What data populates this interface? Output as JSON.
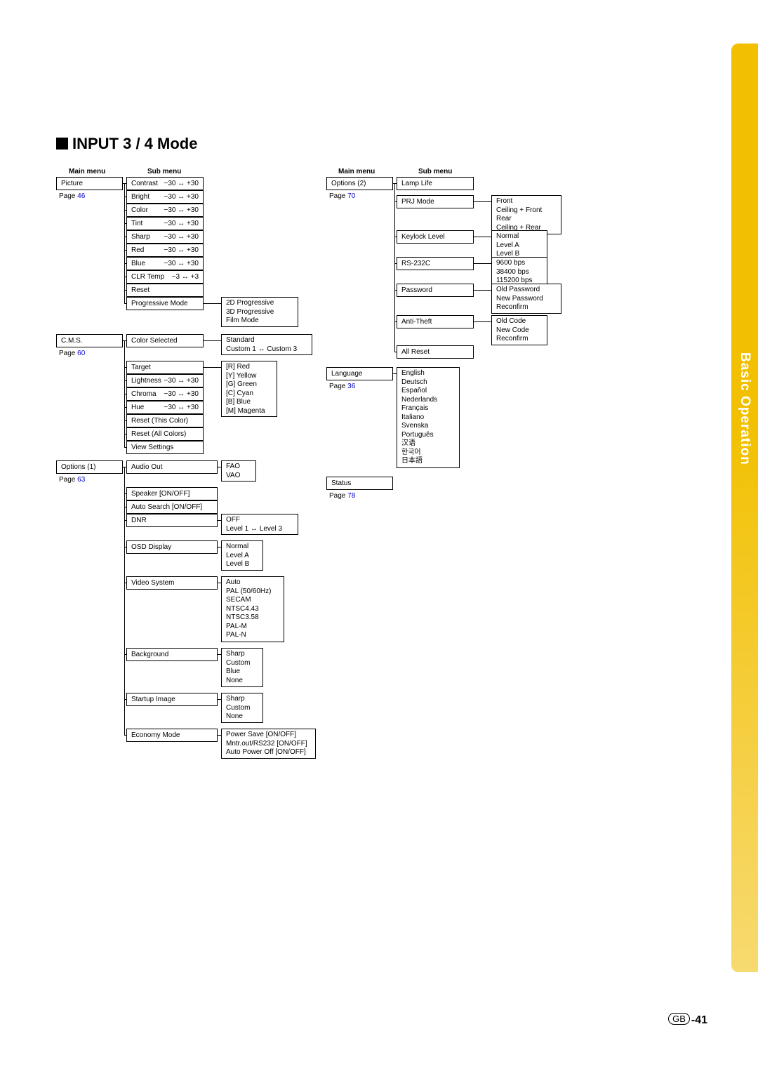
{
  "heading": "INPUT 3 / 4 Mode",
  "side_tab": "Basic Operation",
  "footer_region": "GB",
  "footer_page": "-41",
  "headers": {
    "main_left": "Main menu",
    "sub_left": "Sub menu",
    "main_right": "Main menu",
    "sub_right": "Sub menu"
  },
  "main_left": {
    "picture": {
      "label": "Picture",
      "page": "46"
    },
    "cms": {
      "label": "C.M.S.",
      "page": "60"
    },
    "options1": {
      "label": "Options (1)",
      "page": "63"
    }
  },
  "main_right": {
    "options2": {
      "label": "Options (2)",
      "page": "70"
    },
    "language": {
      "label": "Language",
      "page": "36"
    },
    "status": {
      "label": "Status",
      "page": "78"
    }
  },
  "picture_sub": {
    "contrast": "Contrast",
    "bright": "Bright",
    "color": "Color",
    "tint": "Tint",
    "sharp": "Sharp",
    "red": "Red",
    "blue": "Blue",
    "clr_temp": "CLR Temp",
    "reset": "Reset",
    "progressive": "Progressive Mode"
  },
  "picture_ranges": {
    "r30": "−30 ↔ +30",
    "r3": "−3 ↔ +3"
  },
  "progressive_opts": {
    "a": "2D Progressive",
    "b": "3D Progressive",
    "c": "Film Mode"
  },
  "cms_sub": {
    "color_selected": "Color Selected",
    "target": "Target",
    "lightness": "Lightness",
    "chroma": "Chroma",
    "hue": "Hue",
    "reset_this": "Reset (This Color)",
    "reset_all": "Reset (All Colors)",
    "view": "View Settings"
  },
  "color_selected_opts": {
    "a": "Standard",
    "b": "Custom 1 ↔ Custom 3"
  },
  "target_opts": {
    "r": "[R] Red",
    "y": "[Y] Yellow",
    "g": "[G] Green",
    "c": "[C] Cyan",
    "b": "[B] Blue",
    "m": "[M] Magenta"
  },
  "options1_sub": {
    "audio_out": "Audio Out",
    "speaker": "Speaker [ON/OFF]",
    "auto_search": "Auto Search  [ON/OFF]",
    "dnr": "DNR",
    "osd": "OSD Display",
    "video_system": "Video System",
    "background": "Background",
    "startup": "Startup Image",
    "economy": "Economy Mode"
  },
  "audio_out_opts": {
    "a": "FAO",
    "b": "VAO"
  },
  "dnr_opts": {
    "a": "OFF",
    "b": "Level 1 ↔ Level 3"
  },
  "osd_opts": {
    "a": "Normal",
    "b": "Level A",
    "c": "Level B"
  },
  "video_opts": {
    "a": "Auto",
    "b": "PAL (50/60Hz)",
    "c": "SECAM",
    "d": "NTSC4.43",
    "e": "NTSC3.58",
    "f": "PAL-M",
    "g": "PAL-N"
  },
  "bg_opts": {
    "a": "Sharp",
    "b": "Custom",
    "c": "Blue",
    "d": "None"
  },
  "startup_opts": {
    "a": "Sharp",
    "b": "Custom",
    "c": "None"
  },
  "economy_opts": {
    "a": "Power Save [ON/OFF]",
    "b": "Mntr.out/RS232 [ON/OFF]",
    "c": "Auto Power Off [ON/OFF]"
  },
  "options2_sub": {
    "lamp": "Lamp Life",
    "prj": "PRJ Mode",
    "keylock": "Keylock Level",
    "rs232": "RS-232C",
    "password": "Password",
    "antitheft": "Anti-Theft",
    "allreset": "All Reset"
  },
  "prj_opts": {
    "a": "Front",
    "b": "Ceiling + Front",
    "c": "Rear",
    "d": "Ceiling + Rear"
  },
  "keylock_opts": {
    "a": "Normal",
    "b": "Level A",
    "c": "Level B"
  },
  "rs232_opts": {
    "a": "9600 bps",
    "b": "38400 bps",
    "c": "115200 bps"
  },
  "password_opts": {
    "a": "Old Password",
    "b": "New Password",
    "c": "Reconfirm"
  },
  "antitheft_opts": {
    "a": "Old Code",
    "b": "New Code",
    "c": "Reconfirm"
  },
  "language_opts": {
    "a": "English",
    "b": "Deutsch",
    "c": "Español",
    "d": "Nederlands",
    "e": "Français",
    "f": "Italiano",
    "g": "Svenska",
    "h": "Português",
    "i": "汉语",
    "j": "한국어",
    "k": "日本語"
  },
  "page_word": "Page"
}
